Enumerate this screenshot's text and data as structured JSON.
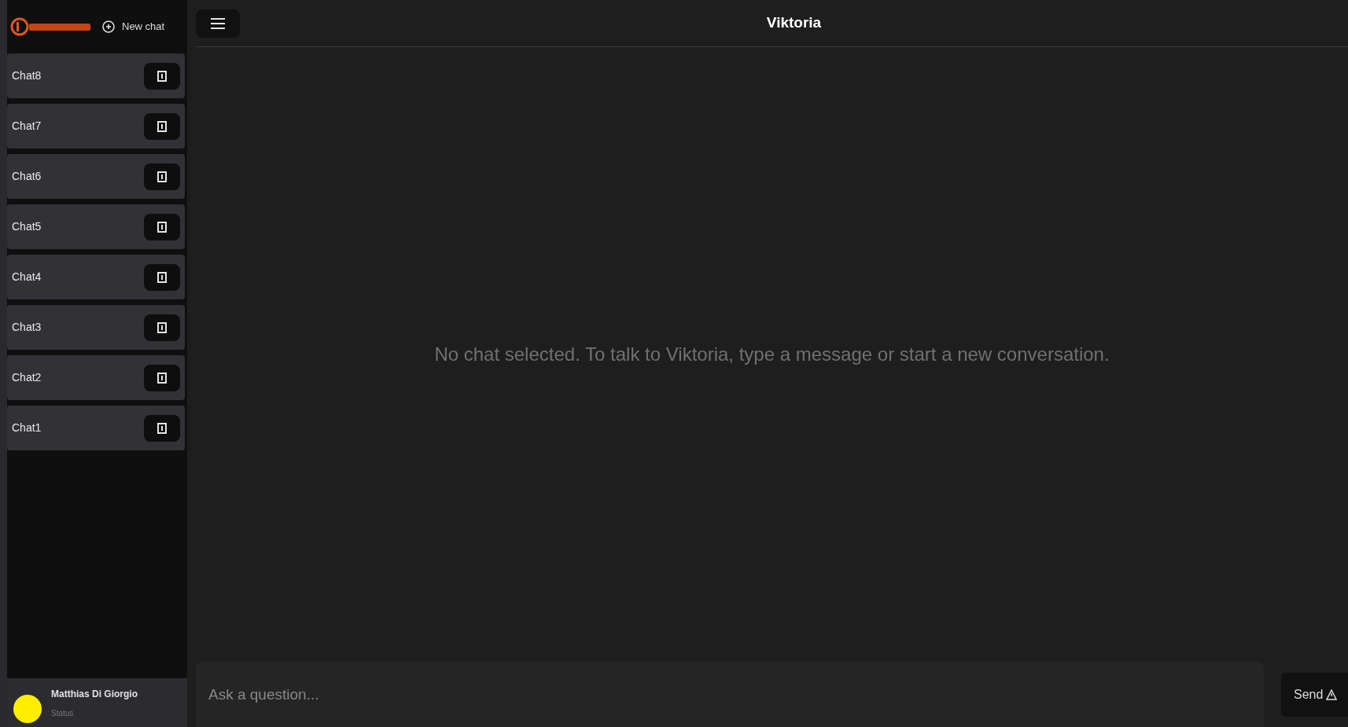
{
  "sidebar": {
    "new_chat": "New chat",
    "chats": [
      {
        "label": "Chat8"
      },
      {
        "label": "Chat7"
      },
      {
        "label": "Chat6"
      },
      {
        "label": "Chat5"
      },
      {
        "label": "Chat4"
      },
      {
        "label": "Chat3"
      },
      {
        "label": "Chat2"
      },
      {
        "label": "Chat1"
      }
    ],
    "user": {
      "name": "Matthias Di Giorgio",
      "status": "Status",
      "color": "#ffee00"
    }
  },
  "header": {
    "title": "Viktoria"
  },
  "empty_message": "No chat selected. To talk to Viktoria, type a message or start a new conversation.",
  "composer": {
    "placeholder": "Ask a question...",
    "send": "Send"
  }
}
